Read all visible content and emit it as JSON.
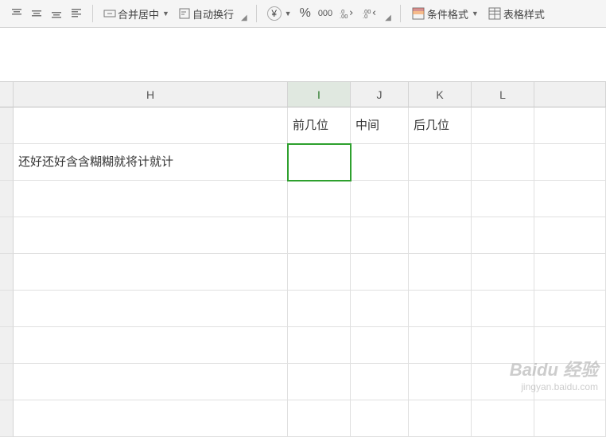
{
  "ribbon": {
    "merge_center": "合并居中",
    "wrap_text": "自动换行",
    "currency_symbol": "¥",
    "percent": "%",
    "comma": "000",
    "increase_decimal": ".00",
    "decrease_decimal": ".0",
    "conditional_format": "条件格式",
    "table_style": "表格样式"
  },
  "columns": [
    "H",
    "I",
    "J",
    "K",
    "L"
  ],
  "active_column": "I",
  "cells": {
    "r1": {
      "H": "",
      "I": "前几位",
      "J": "中间",
      "K": "后几位",
      "L": ""
    },
    "r2": {
      "H": "还好还好含含糊糊就将计就计",
      "I": "",
      "J": "",
      "K": "",
      "L": ""
    }
  },
  "selected_cell": "I2",
  "watermark": {
    "brand": "Baidu 经验",
    "url": "jingyan.baidu.com"
  }
}
